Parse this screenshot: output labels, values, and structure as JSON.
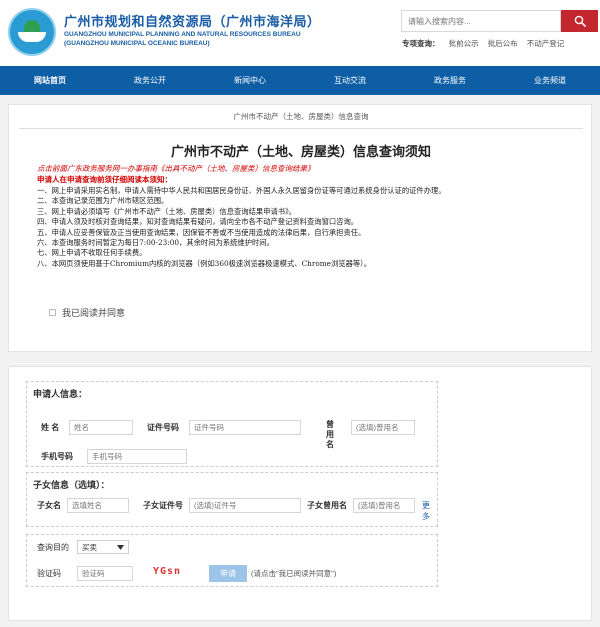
{
  "header": {
    "title": "广州市规划和自然资源局（广州市海洋局）",
    "subtitle_line1": "GUANGZHOU MUNICIPAL PLANNING AND NATURAL RESOURCES BUREAU",
    "subtitle_line2": "(GUANGZHOU MUNICIPAL OCEANIC BUREAU)",
    "search_placeholder": "请输入搜索内容...",
    "quick_label": "专项查询：",
    "quick_links": [
      "批前公示",
      "批后公布",
      "不动产登记"
    ]
  },
  "nav": {
    "items": [
      "网站首页",
      "政务公开",
      "新闻中心",
      "互动交流",
      "政务服务",
      "业务频道"
    ]
  },
  "notice": {
    "breadcrumb": "广州市不动产（土地、房屋类）信息查询",
    "title": "广州市不动产（土地、房屋类）信息查询须知",
    "red_line1": "点击前面广东政务服务网一办事指南《出具不动产（土地、房屋类）信息查询结果》",
    "red_line2": "申请人在申请查询前须仔细阅读本须知：",
    "items": [
      "一、网上申请采用实名制，申请人需持中华人民共和国居民身份证、外国人永久居留身份证等可通过系统身份认证的证件办理。",
      "二、本查询记录范围为广州市辖区范围。",
      "三、网上申请必须填写《广州市不动产（土地、房屋类）信息查询结果申请书》。",
      "四、申请人须及时核对查询结果，知对查询结果有疑问，请向全市各不动产登记资料查询窗口咨询。",
      "五、申请人应妥善保管及正当使用查询结果，因保管不善或不当使用造成的法律后果，自行承担责任。",
      "六、本查询服务时间暂定为每日7:00-23:00，其余时间为系统维护时间。",
      "七、网上申请不收取任何手续费。",
      "八、本网页须使用基于Chromium内核的浏览器（例如360极速浏览器极速模式、Chrome浏览器等）。"
    ],
    "agree_label": "我已阅读并同意"
  },
  "form": {
    "applicant": {
      "title": "申请人信息：",
      "name_label": "姓 名",
      "name_placeholder": "姓名",
      "id_label": "证件号码",
      "id_placeholder": "证件号码",
      "former_label": "曾用名",
      "former_placeholder": "(选填)曾用名",
      "phone_label": "手机号码",
      "phone_placeholder": "手机号码"
    },
    "children": {
      "title": "子女信息（选填）：",
      "name_label": "子女名",
      "name_placeholder": "选填姓名",
      "id_label": "子女证件号",
      "id_placeholder": "(选填)证件号",
      "former_label": "子女曾用名",
      "former_placeholder": "(选填)曾用名",
      "more_label": "更多"
    },
    "query": {
      "purpose_label": "查询目的",
      "purpose_value": "买卖",
      "captcha_label": "验证码",
      "captcha_placeholder": "验证码",
      "captcha_text": "YGsn",
      "submit_label": "申请",
      "hint": "(请点击\"我已阅读并同意\")"
    }
  },
  "colors": {
    "brand_blue": "#0d5ea5",
    "search_red": "#c3262d",
    "notice_red": "#d00000",
    "button_disabled": "#9cc3e8"
  },
  "icons": {
    "logo": "bureau-logo-icon",
    "search": "search-icon",
    "dropdown": "chevron-down-icon"
  }
}
